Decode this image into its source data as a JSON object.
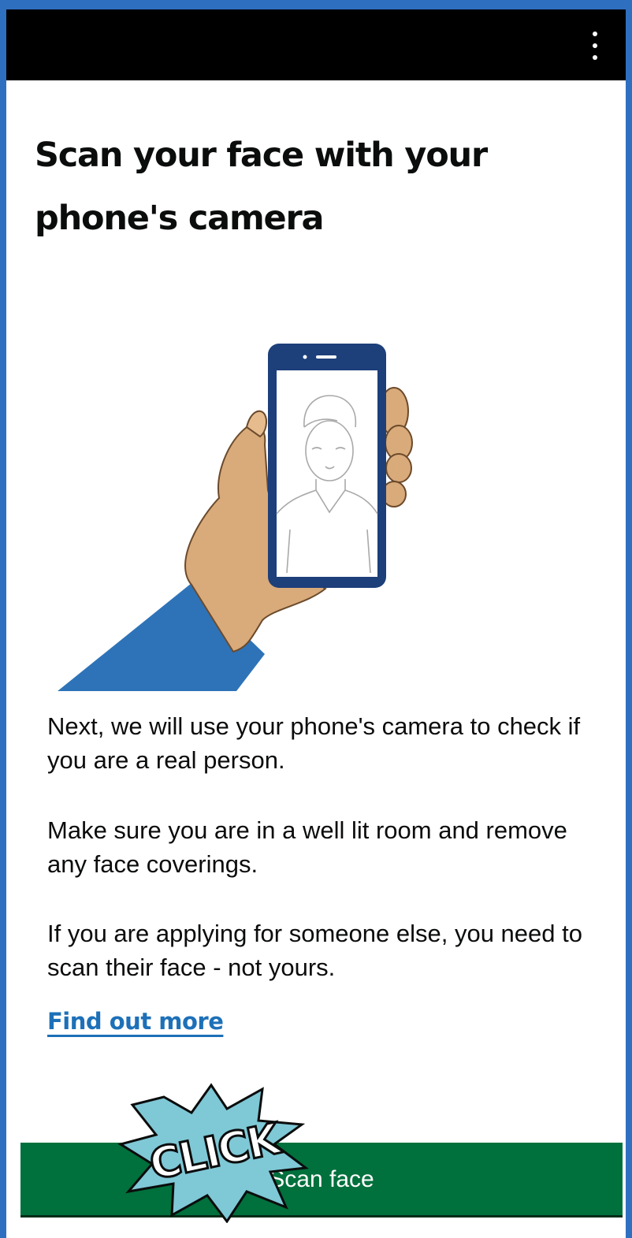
{
  "header": {
    "menu_icon": "more-vert-icon"
  },
  "main": {
    "title": "Scan your face with your phone's camera",
    "paragraphs": [
      "Next, we will use your phone's camera to check if you are a real person.",
      "Make sure you are in a well lit room and remove any face coverings.",
      "If you are applying for someone else, you need to scan their face - not yours."
    ],
    "link_label": "Find out more",
    "button_label": "Scan face"
  },
  "overlay": {
    "text": "CLICK"
  },
  "colors": {
    "frame_border": "#2f6fbf",
    "header_bg": "#000000",
    "link": "#1d70b8",
    "button_bg": "#00703c",
    "sleeve": "#2e73b8",
    "skin": "#d9aa7a",
    "phone": "#1d3f7a",
    "burst": "#7fc8d6"
  }
}
